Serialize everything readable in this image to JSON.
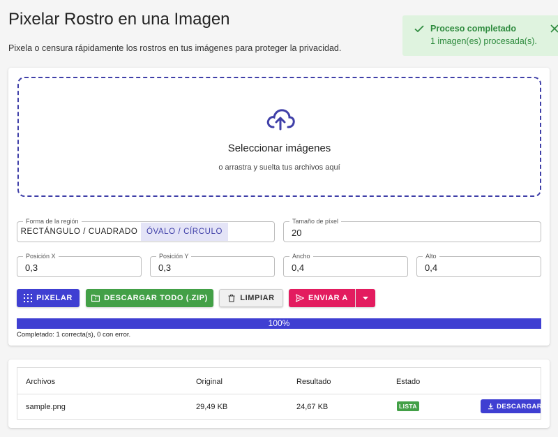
{
  "header": {
    "title": "Pixelar Rostro en una Imagen",
    "subtitle": "Pixela o censura rápidamente los rostros en tus imágenes para proteger la privacidad."
  },
  "toast": {
    "title": "Proceso completado",
    "message": "1 imagen(es) procesada(s)."
  },
  "dropzone": {
    "title": "Seleccionar imágenes",
    "hint": "o arrastra y suelta tus archivos aquí"
  },
  "controls": {
    "shape": {
      "label": "Forma de la región",
      "options": [
        "RECTÁNGULO / CUADRADO",
        "ÓVALO / CÍRCULO"
      ],
      "selected": "ÓVALO / CÍRCULO"
    },
    "pixel_size": {
      "label": "Tamaño de píxel",
      "value": "20"
    },
    "pos_x": {
      "label": "Posición X",
      "value": "0,3"
    },
    "pos_y": {
      "label": "Posición Y",
      "value": "0,3"
    },
    "width": {
      "label": "Ancho",
      "value": "0,4"
    },
    "height": {
      "label": "Alto",
      "value": "0,4"
    }
  },
  "actions": {
    "pixelar": "PIXELAR",
    "download_zip": "DESCARGAR TODO (.ZIP)",
    "clear": "LIMPIAR",
    "send_to": "ENVIAR A"
  },
  "progress": {
    "percent": 100,
    "label": "100%",
    "status": "Completado: 1 correcta(s), 0 con error."
  },
  "table": {
    "headers": [
      "Archivos",
      "Original",
      "Resultado",
      "Estado"
    ],
    "rows": [
      {
        "file": "sample.png",
        "original": "29,49 KB",
        "result": "24,67 KB",
        "status": "LISTA",
        "action": "DESCARGAR"
      }
    ]
  },
  "colors": {
    "primary": "#3f3fd2",
    "success": "#43a047",
    "accent": "#e31c5f",
    "toast_bg": "#dff3df"
  }
}
